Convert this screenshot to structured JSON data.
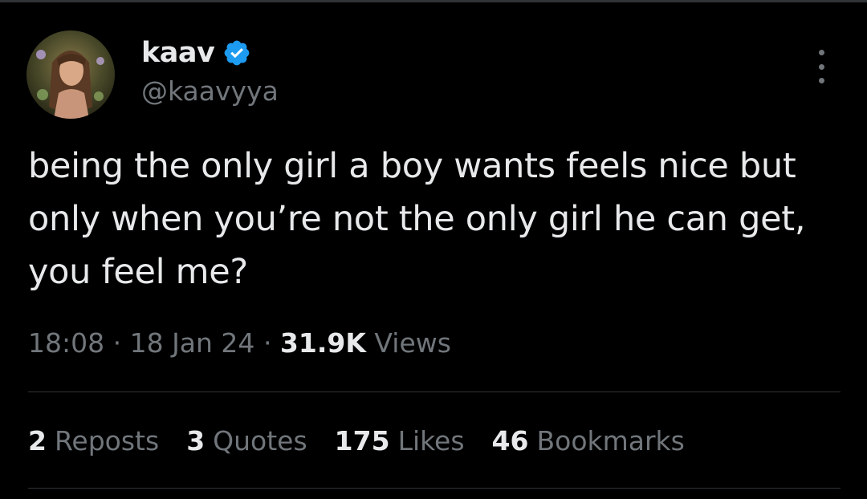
{
  "tweet": {
    "author": {
      "display_name": "kaav",
      "handle": "@kaavyya",
      "verified": true,
      "avatar_icon": "avatar-portrait-icon"
    },
    "text": "being the only girl a boy wants feels nice but\nonly when you’re not the only girl he can get,\nyou feel me?",
    "meta": {
      "time": "18:08",
      "separator": "·",
      "date": "18 Jan 24",
      "views_count": "31.9K",
      "views_label": "Views"
    },
    "stats": [
      {
        "count": "2",
        "label": "Reposts"
      },
      {
        "count": "3",
        "label": "Quotes"
      },
      {
        "count": "175",
        "label": "Likes"
      },
      {
        "count": "46",
        "label": "Bookmarks"
      }
    ]
  },
  "colors": {
    "background": "#000000",
    "primary_text": "#e7e9ea",
    "secondary_text": "#71767b",
    "divider": "#2f3336",
    "verified_badge": "#1d9bf0"
  }
}
